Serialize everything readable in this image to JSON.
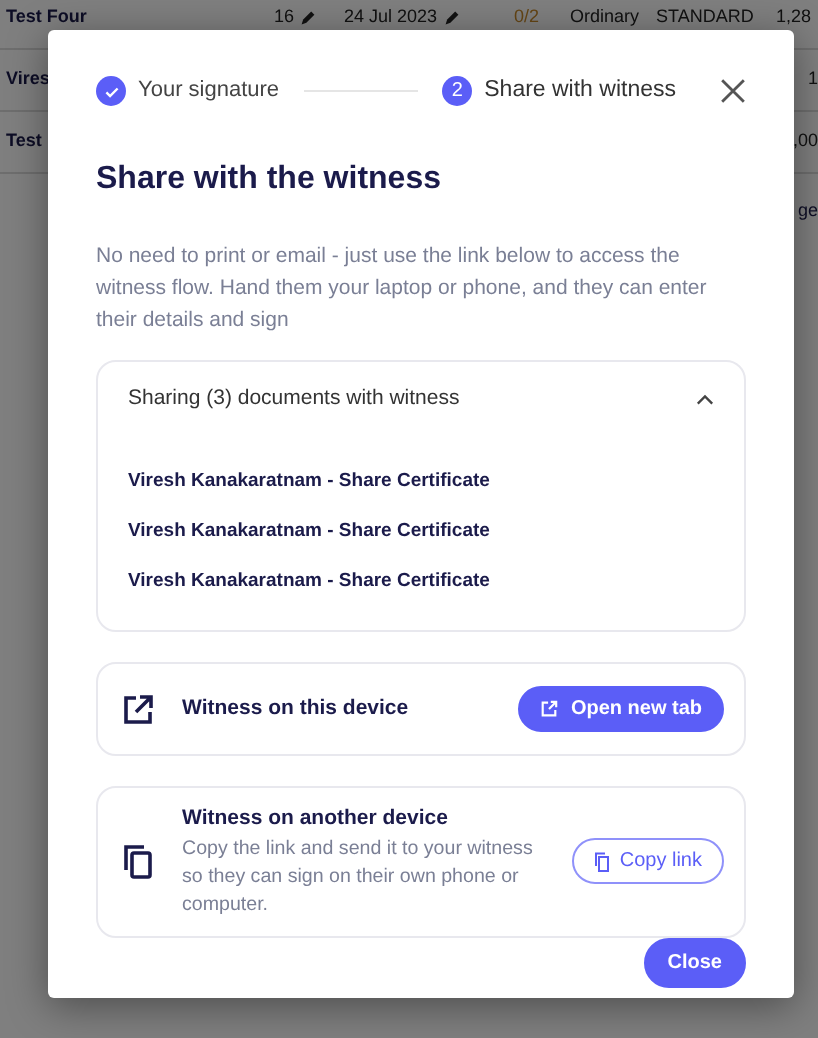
{
  "background_table": {
    "rows": [
      {
        "cells": [
          {
            "text": "Test Four",
            "kind": "name"
          },
          {
            "text": "16",
            "kind": "edit"
          },
          {
            "text": "24 Jul 2023",
            "kind": "edit"
          },
          {
            "text": "0/2",
            "kind": "count"
          },
          {
            "text": "Ordinary",
            "kind": "plain"
          },
          {
            "text": "STANDARD",
            "kind": "plain"
          },
          {
            "text": "1,28",
            "kind": "plain"
          }
        ]
      },
      {
        "cells": [
          {
            "text": "Vires",
            "kind": "name"
          },
          {
            "text": "1",
            "kind": "edge"
          }
        ]
      },
      {
        "cells": [
          {
            "text": "Test",
            "kind": "name"
          },
          {
            "text": ",00",
            "kind": "edge"
          }
        ]
      }
    ],
    "footer_text": "ge"
  },
  "modal": {
    "steps": [
      {
        "label": "Your signature",
        "done": true
      },
      {
        "label": "Share with witness",
        "done": false,
        "number": "2"
      }
    ],
    "title": "Share with the witness",
    "description": "No need to print or email - just use the link below to access the witness flow. Hand them your laptop or phone, and they can enter their details and sign",
    "documents": {
      "header": "Sharing (3) documents with witness",
      "expanded": true,
      "items": [
        "Viresh Kanakaratnam - Share Certificate",
        "Viresh Kanakaratnam - Share Certificate",
        "Viresh Kanakaratnam - Share Certificate"
      ]
    },
    "options": [
      {
        "kind": "this_device",
        "title": "Witness on this device",
        "button": "Open new tab"
      },
      {
        "kind": "other_device",
        "title": "Witness on another device",
        "text": "Copy the link and send it to your witness so they can sign on their own phone or computer.",
        "button": "Copy link"
      }
    ],
    "close_button": "Close"
  }
}
